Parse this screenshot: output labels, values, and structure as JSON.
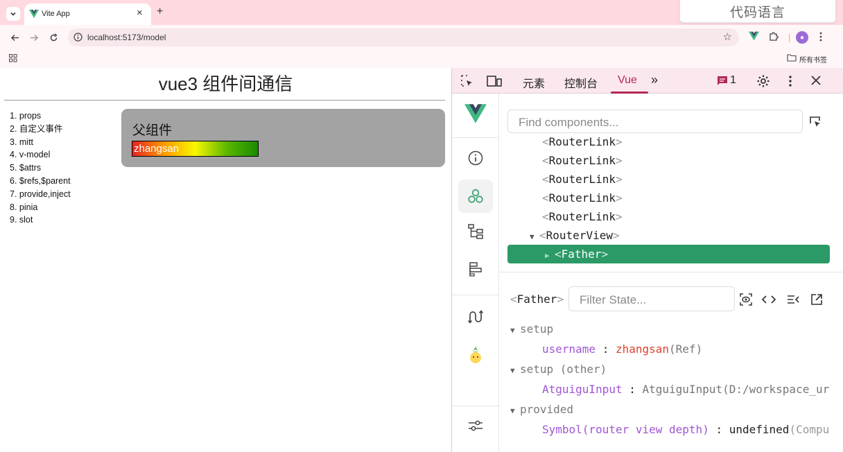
{
  "browser": {
    "tab": {
      "title": "Vite App"
    },
    "overlay_label": "代码语言",
    "url": "localhost:5173/model",
    "bookmarks": {
      "all_label": "所有书签"
    },
    "colors": {
      "tabstrip": "#ffd9e0",
      "vue_green": "#41b883"
    }
  },
  "page": {
    "title": "vue3 组件间通信",
    "nav": [
      "1. props",
      "2. 自定义事件",
      "3. mitt",
      "4. v-model",
      "5. $attrs",
      "6. $refs,$parent",
      "7. provide,inject",
      "8. pinia",
      "9. slot"
    ],
    "father": {
      "title": "父组件",
      "input_value": "zhangsan"
    }
  },
  "devtools": {
    "tabs": [
      {
        "label": "元素",
        "active": false
      },
      {
        "label": "控制台",
        "active": false
      },
      {
        "label": "Vue",
        "active": true
      }
    ],
    "issue_count": "1",
    "vue": {
      "search_placeholder": "Find components...",
      "tree": [
        {
          "name": "RouterLink",
          "indent": 1,
          "expanded": null,
          "selected": false
        },
        {
          "name": "RouterLink",
          "indent": 1,
          "expanded": null,
          "selected": false
        },
        {
          "name": "RouterLink",
          "indent": 1,
          "expanded": null,
          "selected": false
        },
        {
          "name": "RouterLink",
          "indent": 1,
          "expanded": null,
          "selected": false
        },
        {
          "name": "RouterLink",
          "indent": 1,
          "expanded": null,
          "selected": false
        },
        {
          "name": "RouterView",
          "indent": 1,
          "expanded": true,
          "selected": false
        },
        {
          "name": "Father",
          "indent": 2,
          "expanded": false,
          "selected": true
        }
      ],
      "inspector": {
        "component": "Father",
        "filter_placeholder": "Filter State...",
        "sections": {
          "setup": "setup",
          "setup_other": "setup (other)",
          "provided": "provided"
        },
        "rows": {
          "username_key": "username",
          "username_value": "zhangsan",
          "username_type": "(Ref)",
          "input_key": "AtguiguInput",
          "input_value": "AtguiguInput(D:/workspace_ur",
          "symbol_key": "Symbol(router view depth)",
          "symbol_value": "undefined",
          "symbol_type": "(Compu"
        }
      }
    }
  }
}
